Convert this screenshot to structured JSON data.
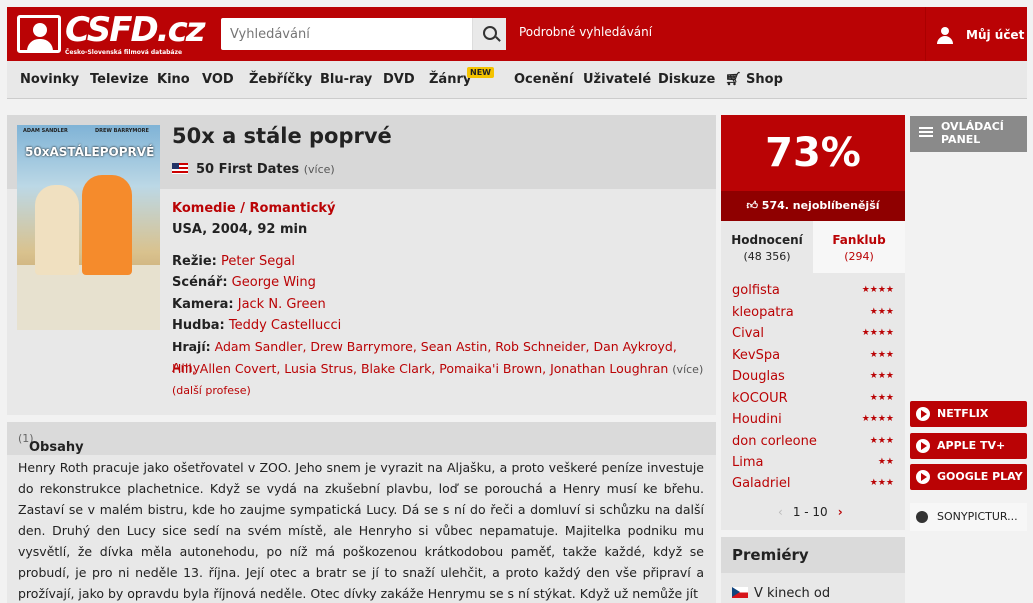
{
  "header": {
    "logo_text": "CSFD.cz",
    "logo_sub": "Česko-Slovenská filmová databáze",
    "search_placeholder": "Vyhledávání",
    "advanced_search": "Podrobné vyhledávání",
    "account": "Můj účet"
  },
  "nav": {
    "items": [
      "Novinky",
      "Televize",
      "Kino",
      "VOD",
      "Žebříčky",
      "Blu-ray",
      "DVD",
      "Žánry",
      "Ocenění",
      "Uživatelé",
      "Diskuze",
      "Shop"
    ],
    "new_badge": "NEW"
  },
  "movie": {
    "title": "50x a stále poprvé",
    "original_title": "50 First Dates",
    "more": "(více)",
    "poster_names": [
      "ADAM SANDLER",
      "DREW BARRYMORE"
    ],
    "poster_title": "50xASTÁLEPOPRVÉ",
    "genres": "Komedie / Romantický",
    "origin": "USA, 2004, 92 min",
    "crew": [
      {
        "label": "Režie:",
        "value": "Peter Segal"
      },
      {
        "label": "Scénář:",
        "value": "George Wing"
      },
      {
        "label": "Kamera:",
        "value": "Jack N. Green"
      },
      {
        "label": "Hudba:",
        "value": "Teddy Castellucci"
      }
    ],
    "cast_label": "Hrají:",
    "cast_line1": "Adam Sandler, Drew Barrymore, Sean Astin, Rob Schneider, Dan Aykroyd, Amy",
    "cast_line2": "Hill, Allen Covert, Lusia Strus, Blake Clark, Pomaika'i Brown, Jonathan Loughran",
    "cast_more": "(více)",
    "professions": "(další profese)"
  },
  "plot": {
    "header": "Obsahy",
    "count": "(1)",
    "text": "Henry Roth pracuje jako ošetřovatel v ZOO. Jeho snem je vyrazit na Aljašku, a proto veškeré peníze investuje do rekonstrukce plachetnice. Když se vydá na zkušební plavbu, loď se porouchá a Henry musí ke břehu. Zastaví se v malém bistru, kde ho zaujme sympatická Lucy. Dá se s ní do řeči a domluví si schůzku na další den. Druhý den Lucy sice sedí na svém místě, ale Henryho si vůbec nepamatuje. Majitelka podniku mu vysvětlí, že dívka měla autonehodu, po níž má poškozenou krátkodobou paměť, takže každé, když se probudí, je pro ni neděle 13. října. Její otec a bratr se jí to snaží ulehčit, a proto každý den vše připraví a prožívají, jako by opravdu byla říjnová neděle. Otec dívky zakáže Henrymu se s ní stýkat. Když už nemůže jít"
  },
  "rating": {
    "score": "73%",
    "rank": "574. nejoblíbenější",
    "tab1_label": "Hodnocení",
    "tab1_count": "(48 356)",
    "tab2_label": "Fanklub",
    "tab2_count": "(294)",
    "users": [
      {
        "name": "golfista",
        "stars": "★★★★"
      },
      {
        "name": "kleopatra",
        "stars": "★★★"
      },
      {
        "name": "Cival",
        "stars": "★★★★"
      },
      {
        "name": "KevSpa",
        "stars": "★★★"
      },
      {
        "name": "Douglas",
        "stars": "★★★"
      },
      {
        "name": "kOCOUR",
        "stars": "★★★"
      },
      {
        "name": "Houdini",
        "stars": "★★★★"
      },
      {
        "name": "don corleone",
        "stars": "★★★"
      },
      {
        "name": "Lima",
        "stars": "★★"
      },
      {
        "name": "Galadriel",
        "stars": "★★★"
      }
    ],
    "pager": "1 - 10"
  },
  "premiery": {
    "header": "Premiéry",
    "row": "V kinech od"
  },
  "side": {
    "panel": "OVLÁDACÍ PANEL",
    "vod": [
      "NETFLIX",
      "APPLE TV+",
      "GOOGLE PLAY"
    ],
    "distributor": "SONYPICTUR..."
  },
  "colors": {
    "brand": "#ba0305",
    "nav_bg": "#e8e8e8"
  }
}
